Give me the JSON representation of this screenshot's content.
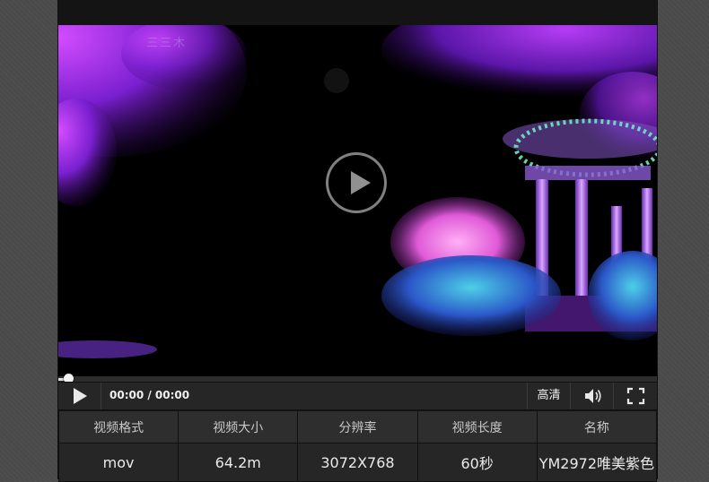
{
  "player": {
    "watermark": "三三木",
    "time_display": "00:00 / 00:00",
    "quality_label": "高清",
    "progress_fraction": 0.0
  },
  "info_table": {
    "headers": [
      "视频格式",
      "视频大小",
      "分辨率",
      "视频长度",
      "名称"
    ],
    "values": [
      "mov",
      "64.2m",
      "3072X768",
      "60秒",
      "YM2972唯美紫色"
    ]
  },
  "colors": {
    "accent_purple": "#a23cf0",
    "accent_pink": "#f06adf",
    "accent_teal": "#3fd6b8"
  },
  "icons": [
    "play-icon",
    "volume-icon",
    "fullscreen-icon"
  ]
}
